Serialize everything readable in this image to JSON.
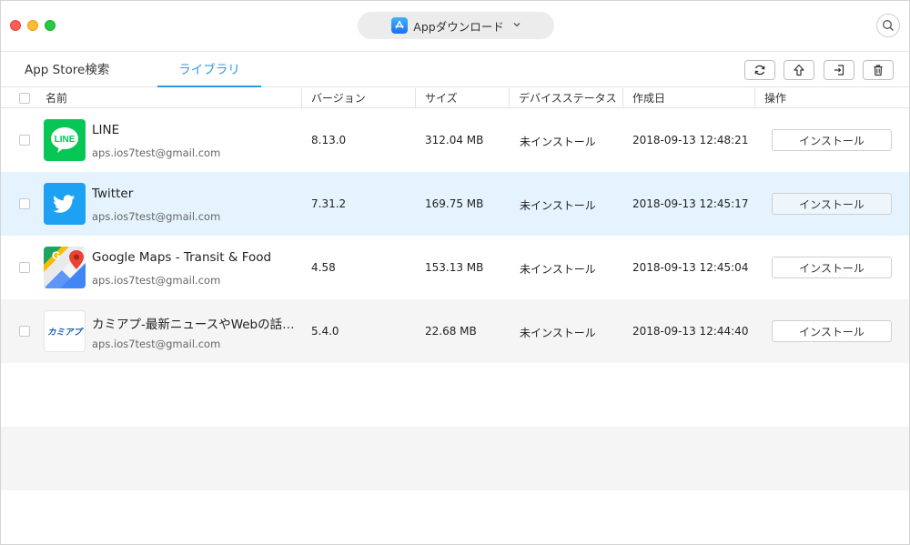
{
  "titlebar": {
    "title": "Appダウンロード"
  },
  "tabs": {
    "store": "App Store検索",
    "library": "ライブラリ"
  },
  "columns": {
    "name": "名前",
    "version": "バージョン",
    "size": "サイズ",
    "status": "デバイスステータス",
    "date": "作成日",
    "action": "操作"
  },
  "apps": [
    {
      "name": "LINE",
      "account": "aps.ios7test@gmail.com",
      "version": "8.13.0",
      "size": "312.04 MB",
      "status": "未インストール",
      "date": "2018-09-13 12:48:21",
      "action": "インストール",
      "icon": "line-icon"
    },
    {
      "name": "Twitter",
      "account": "aps.ios7test@gmail.com",
      "version": "7.31.2",
      "size": "169.75 MB",
      "status": "未インストール",
      "date": "2018-09-13 12:45:17",
      "action": "インストール",
      "icon": "twitter-icon"
    },
    {
      "name": "Google Maps - Transit & Food",
      "account": "aps.ios7test@gmail.com",
      "version": "4.58",
      "size": "153.13 MB",
      "status": "未インストール",
      "date": "2018-09-13 12:45:04",
      "action": "インストール",
      "icon": "google-maps-icon"
    },
    {
      "name": "カミアプ-最新ニュースやWebの話…",
      "account": "aps.ios7test@gmail.com",
      "version": "5.4.0",
      "size": "22.68 MB",
      "status": "未インストール",
      "date": "2018-09-13 12:44:40",
      "action": "インストール",
      "icon": "kamiapu-icon",
      "icon_text": "カミアプ"
    }
  ],
  "colors": {
    "accent": "#2a9be6",
    "selected_row": "#e4f3fd",
    "alt_row": "#f5f5f5",
    "line_green": "#06c755",
    "twitter_blue": "#1da1f2"
  }
}
